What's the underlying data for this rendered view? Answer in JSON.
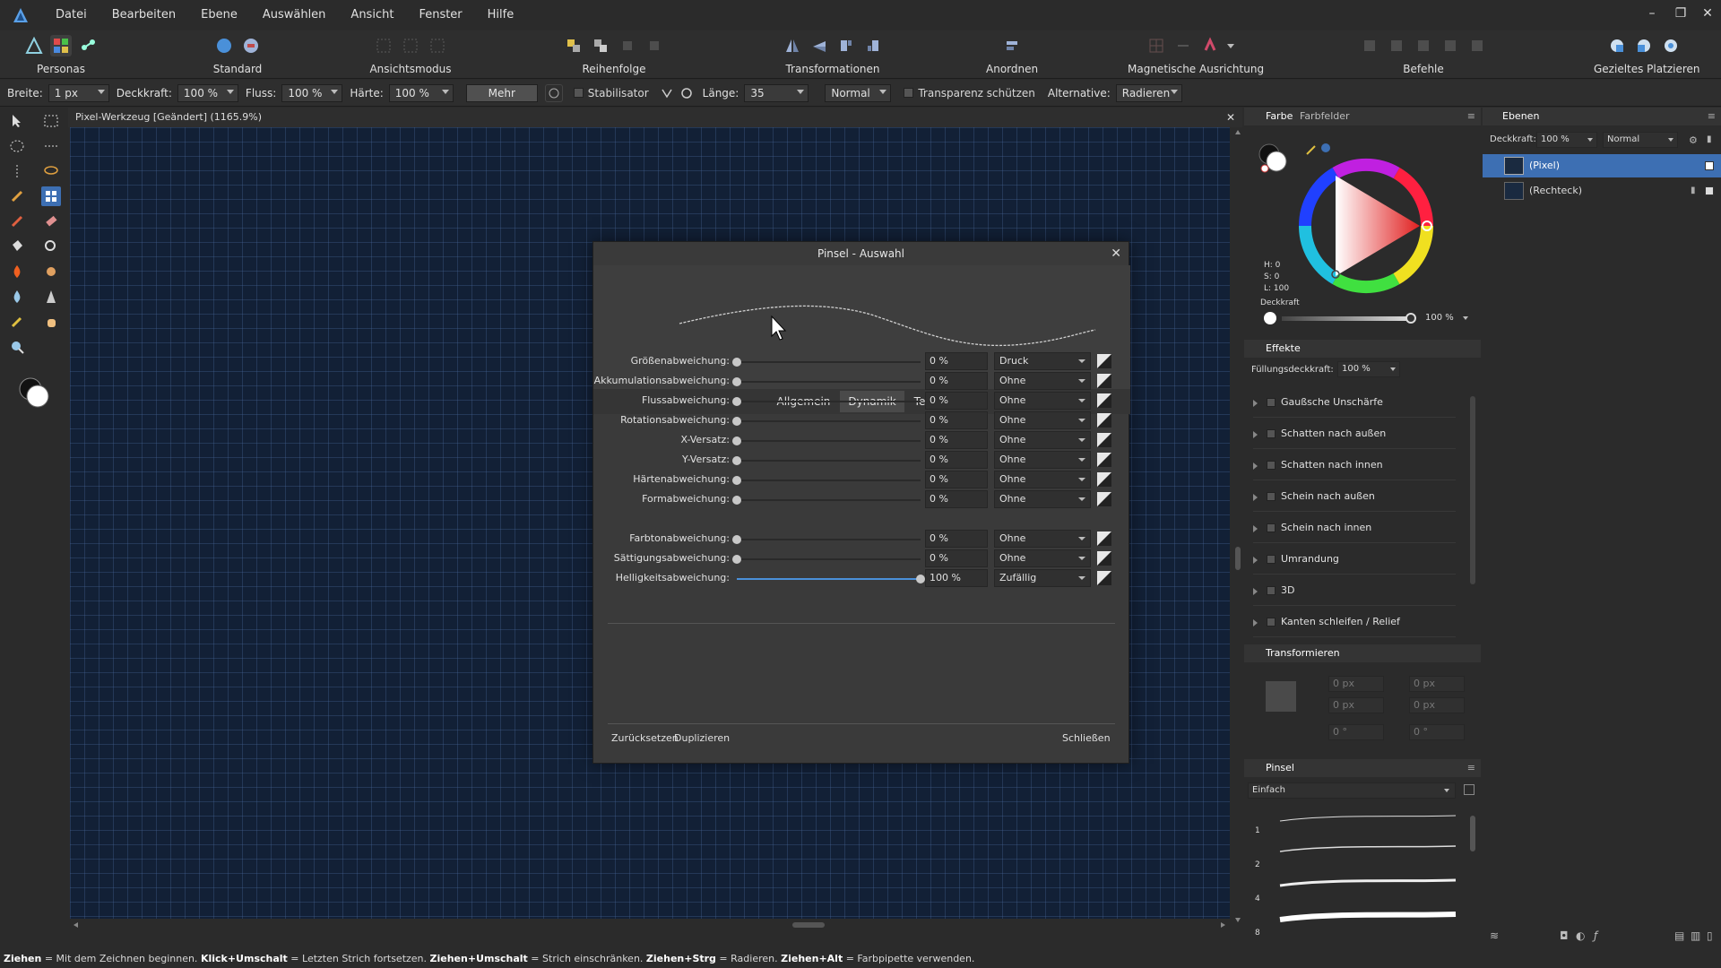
{
  "menubar": {
    "items": [
      "Datei",
      "Bearbeiten",
      "Ebene",
      "Auswählen",
      "Ansicht",
      "Fenster",
      "Hilfe"
    ]
  },
  "toolbar": {
    "groups": [
      {
        "label": "Personas"
      },
      {
        "label": "Standard"
      },
      {
        "label": "Ansichtsmodus"
      },
      {
        "label": "Reihenfolge"
      },
      {
        "label": "Transformationen"
      },
      {
        "label": "Anordnen"
      },
      {
        "label": "Magnetische Ausrichtung"
      },
      {
        "label": "Befehle"
      },
      {
        "label": "Gezieltes Platzieren"
      }
    ]
  },
  "context": {
    "breite_label": "Breite:",
    "breite_value": "1 px",
    "deckkraft_label": "Deckkraft:",
    "deckkraft_value": "100 %",
    "fluss_label": "Fluss:",
    "fluss_value": "100 %",
    "haerte_label": "Härte:",
    "haerte_value": "100 %",
    "mehr_label": "Mehr",
    "stabilisator_label": "Stabilisator",
    "laenge_label": "Länge:",
    "laenge_value": "35",
    "blend_value": "Normal",
    "transparenz_label": "Transparenz schützen",
    "alternative_label": "Alternative:",
    "alternative_value": "Radieren"
  },
  "document": {
    "title": "Pixel-Werkzeug [Geändert] (1165.9%)"
  },
  "dialog": {
    "title": "Pinsel - Auswahl",
    "tabs": [
      "Allgemein",
      "Dynamik",
      "Textur"
    ],
    "active_tab": "Dynamik",
    "rows": [
      {
        "label": "Größenabweichung:",
        "value": "0 %",
        "controller": "Druck",
        "level": 0
      },
      {
        "label": "Akkumulationsabweichung:",
        "value": "0 %",
        "controller": "Ohne",
        "level": 0
      },
      {
        "label": "Flussabweichung:",
        "value": "0 %",
        "controller": "Ohne",
        "level": 0
      },
      {
        "label": "Rotationsabweichung:",
        "value": "0 %",
        "controller": "Ohne",
        "level": 0
      },
      {
        "label": "X-Versatz:",
        "value": "0 %",
        "controller": "Ohne",
        "level": 0
      },
      {
        "label": "Y-Versatz:",
        "value": "0 %",
        "controller": "Ohne",
        "level": 0
      },
      {
        "label": "Härtenabweichung:",
        "value": "0 %",
        "controller": "Ohne",
        "level": 0
      },
      {
        "label": "Formabweichung:",
        "value": "0 %",
        "controller": "Ohne",
        "level": 0
      },
      {
        "label": "Farbtonabweichung:",
        "value": "0 %",
        "controller": "Ohne",
        "level": 0
      },
      {
        "label": "Sättigungsabweichung:",
        "value": "0 %",
        "controller": "Ohne",
        "level": 0
      },
      {
        "label": "Helligkeitsabweichung:",
        "value": "100 %",
        "controller": "Zufällig",
        "level": 1
      }
    ],
    "reset_label": "Zurücksetzen",
    "duplicate_label": "Duplizieren",
    "close_label": "Schließen"
  },
  "color_panel": {
    "tabs": [
      "Farbe",
      "Farbfelder"
    ],
    "h": "H: 0",
    "s": "S: 0",
    "l": "L: 100",
    "opacity_label": "Deckkraft",
    "opacity_value": "100 %"
  },
  "effects_panel": {
    "title": "Effekte",
    "fill_opacity_label": "Füllungsdeckkraft:",
    "fill_opacity_value": "100 %",
    "items": [
      "Gaußsche Unschärfe",
      "Schatten nach außen",
      "Schatten nach innen",
      "Schein nach außen",
      "Schein nach innen",
      "Umrandung",
      "3D",
      "Kanten schleifen / Relief"
    ]
  },
  "transform_panel": {
    "title": "Transformieren",
    "x": "0 px",
    "y": "0 px",
    "w": "0 px",
    "h": "0 px",
    "r": "0 °",
    "s": "0 °"
  },
  "brush_panel": {
    "title": "Pinsel",
    "category": "Einfach",
    "sizes": [
      "1",
      "2",
      "4",
      "8"
    ]
  },
  "layers_panel": {
    "title": "Ebenen",
    "opacity_label": "Deckkraft:",
    "opacity_value": "100 %",
    "blend_value": "Normal",
    "layers": [
      "(Pixel)",
      "(Rechteck)"
    ]
  },
  "status": {
    "k1": "Ziehen",
    "t1": " = Mit dem Zeichnen beginnen. ",
    "k2": "Klick+Umschalt",
    "t2": " = Letzten Strich fortsetzen. ",
    "k3": "Ziehen+Umschalt",
    "t3": " = Strich einschränken. ",
    "k4": "Ziehen+Strg",
    "t4": " = Radieren. ",
    "k5": "Ziehen+Alt",
    "t5": " = Farbpipette verwenden."
  },
  "colors": {
    "accent": "#4a90d9",
    "canvas": "#122036",
    "layer_selected": "#3d6fb3"
  }
}
